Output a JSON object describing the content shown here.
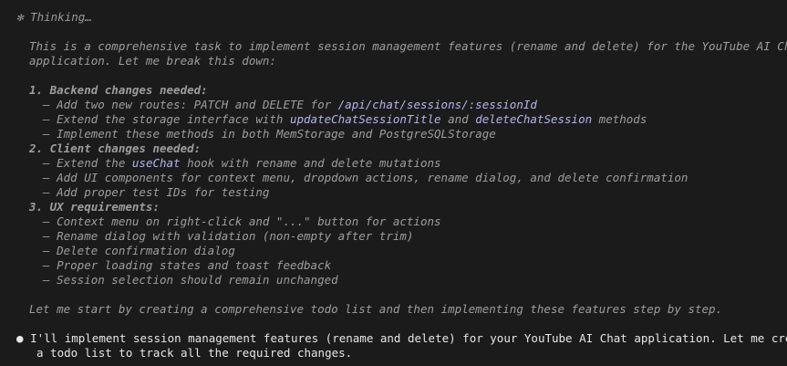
{
  "thinking": {
    "icon": "✻",
    "label": "Thinking…",
    "intro": [
      "This is a comprehensive task to implement session management features (rename and delete) for the YouTube AI Chat",
      "application. Let me break this down:"
    ],
    "sections": [
      {
        "heading": "1. Backend changes needed:",
        "items": [
          {
            "pre": "  – Add two new routes: PATCH and DELETE for ",
            "code": "/api/chat/sessions/:sessionId",
            "mid": "",
            "code2": "",
            "post": ""
          },
          {
            "pre": "  – Extend the storage interface with ",
            "code": "updateChatSessionTitle",
            "mid": " and ",
            "code2": "deleteChatSession",
            "post": " methods"
          },
          {
            "pre": "  – Implement these methods in both MemStorage and PostgreSQLStorage",
            "code": "",
            "mid": "",
            "code2": "",
            "post": ""
          }
        ]
      },
      {
        "heading": "2. Client changes needed:",
        "items": [
          {
            "pre": "  – Extend the ",
            "code": "useChat",
            "mid": " hook with rename and delete mutations",
            "code2": "",
            "post": ""
          },
          {
            "pre": "  – Add UI components for context menu, dropdown actions, rename dialog, and delete confirmation",
            "code": "",
            "mid": "",
            "code2": "",
            "post": ""
          },
          {
            "pre": "  – Add proper test IDs for testing",
            "code": "",
            "mid": "",
            "code2": "",
            "post": ""
          }
        ]
      },
      {
        "heading": "3. UX requirements:",
        "items": [
          {
            "pre": "  – Context menu on right-click and \"...\" button for actions",
            "code": "",
            "mid": "",
            "code2": "",
            "post": ""
          },
          {
            "pre": "  – Rename dialog with validation (non-empty after trim)",
            "code": "",
            "mid": "",
            "code2": "",
            "post": ""
          },
          {
            "pre": "  – Delete confirmation dialog",
            "code": "",
            "mid": "",
            "code2": "",
            "post": ""
          },
          {
            "pre": "  – Proper loading states and toast feedback",
            "code": "",
            "mid": "",
            "code2": "",
            "post": ""
          },
          {
            "pre": "  – Session selection should remain unchanged",
            "code": "",
            "mid": "",
            "code2": "",
            "post": ""
          }
        ]
      }
    ],
    "conclusion": "Let me start by creating a comprehensive todo list and then implementing these features step by step."
  },
  "response": {
    "bullet": "●",
    "lines": [
      "I'll implement session management features (rename and delete) for your YouTube AI Chat application. Let me create",
      "a todo list to track all the required changes."
    ]
  }
}
